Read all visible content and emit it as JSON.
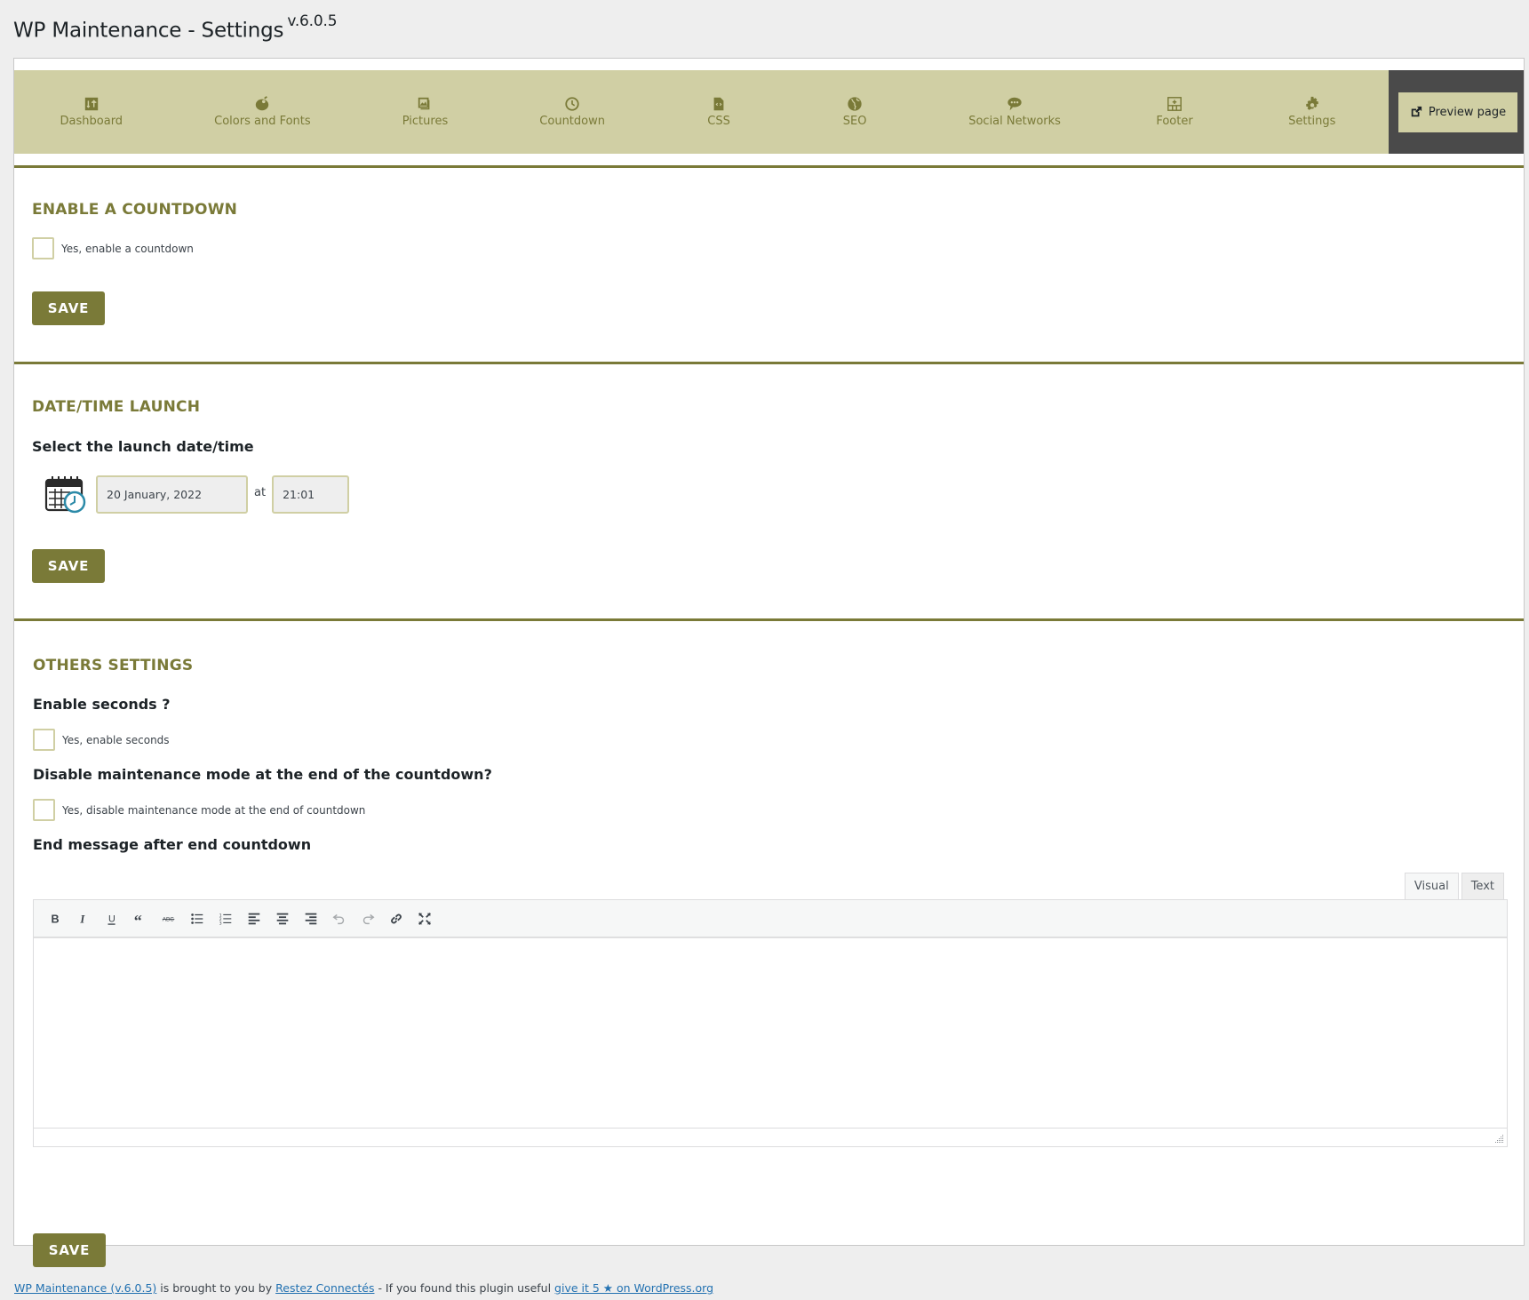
{
  "page": {
    "title": "WP Maintenance - Settings",
    "version": "v.6.0.5"
  },
  "nav": {
    "tabs": [
      {
        "label": "Dashboard",
        "icon": "dashboard-icon"
      },
      {
        "label": "Colors and Fonts",
        "icon": "palette-icon"
      },
      {
        "label": "Pictures",
        "icon": "pictures-icon"
      },
      {
        "label": "Countdown",
        "icon": "clock-icon"
      },
      {
        "label": "CSS",
        "icon": "css-file-icon"
      },
      {
        "label": "SEO",
        "icon": "globe-icon"
      },
      {
        "label": "Social Networks",
        "icon": "chat-bubble-icon"
      },
      {
        "label": "Footer",
        "icon": "footer-layout-icon"
      },
      {
        "label": "Settings",
        "icon": "gear-icon"
      }
    ],
    "preview_label": "Preview page",
    "preview_icon": "external-link-icon"
  },
  "colors": {
    "accent": "#7a7a38",
    "tabbar_bg": "#d0cfa4",
    "preview_zone_bg": "#4a4a4a",
    "link": "#2271b1"
  },
  "countdown_section": {
    "heading": "ENABLE A COUNTDOWN",
    "enable_label": "Yes, enable a countdown",
    "enable_checked": false,
    "save_label": "SAVE"
  },
  "datetime_section": {
    "heading": "DATE/TIME LAUNCH",
    "prompt": "Select the launch date/time",
    "date_value": "20 January, 2022",
    "at_label": "at",
    "time_value": "21:01",
    "save_label": "SAVE"
  },
  "others_section": {
    "heading": "OTHERS SETTINGS",
    "seconds_question": "Enable seconds ?",
    "seconds_label": "Yes, enable seconds",
    "seconds_checked": false,
    "disable_question": "Disable maintenance mode at the end of the countdown?",
    "disable_label": "Yes, disable maintenance mode at the end of countdown",
    "disable_checked": false,
    "end_message_label": "End message after end countdown",
    "editor": {
      "tabs": [
        "Visual",
        "Text"
      ],
      "active_tab": "Visual",
      "content": "",
      "toolbar": [
        "bold",
        "italic",
        "underline",
        "blockquote",
        "strikethrough",
        "bulleted-list",
        "numbered-list",
        "align-left",
        "align-center",
        "align-right",
        "undo",
        "redo",
        "insert-link",
        "fullscreen"
      ]
    },
    "save_label": "SAVE"
  },
  "credits": {
    "plugin_link": "WP Maintenance (v.6.0.5)",
    "text1": " is brought to you by ",
    "author_link": "Restez Connectés",
    "text2": " - If you found this plugin useful ",
    "rate_link": "give it 5 ★ on WordPress.org"
  }
}
